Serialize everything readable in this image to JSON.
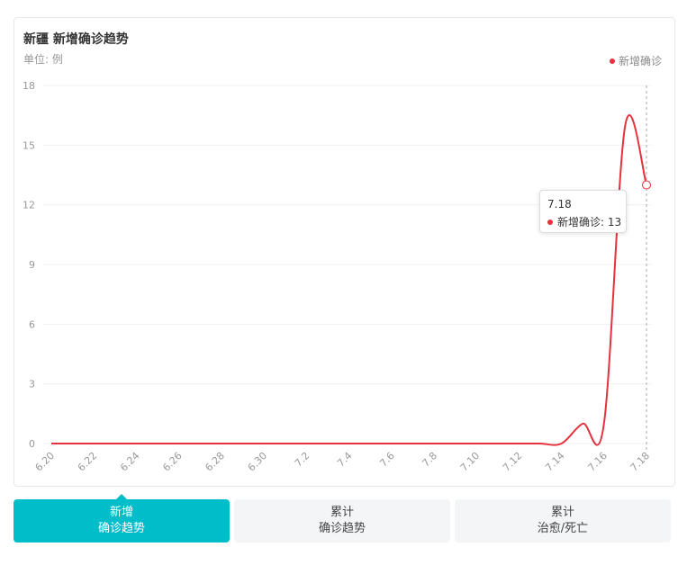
{
  "card": {
    "title": "新疆 新增确诊趋势",
    "unit": "单位: 例",
    "legend": "新增确诊"
  },
  "tooltip": {
    "date": "7.18",
    "label": "新增确诊: 13"
  },
  "tabs": [
    {
      "line1": "新增",
      "line2": "确诊趋势",
      "active": true
    },
    {
      "line1": "累计",
      "line2": "确诊趋势",
      "active": false
    },
    {
      "line1": "累计",
      "line2": "治愈/死亡",
      "active": false
    }
  ],
  "colors": {
    "line": "#e5323e",
    "accent": "#00bec9"
  },
  "chart_data": {
    "type": "line",
    "title": "新疆 新增确诊趋势",
    "ylabel": "单位: 例",
    "ylim": [
      0,
      18
    ],
    "yticks": [
      0,
      3,
      6,
      9,
      12,
      15,
      18
    ],
    "x": [
      "6.20",
      "6.21",
      "6.22",
      "6.23",
      "6.24",
      "6.25",
      "6.26",
      "6.27",
      "6.28",
      "6.29",
      "6.30",
      "7.1",
      "7.2",
      "7.3",
      "7.4",
      "7.5",
      "7.6",
      "7.7",
      "7.8",
      "7.9",
      "7.10",
      "7.11",
      "7.12",
      "7.13",
      "7.14",
      "7.15",
      "7.16",
      "7.17",
      "7.18"
    ],
    "xtick_labels": [
      "6.20",
      "6.22",
      "6.24",
      "6.26",
      "6.28",
      "6.30",
      "7.2",
      "7.4",
      "7.6",
      "7.8",
      "7.10",
      "7.12",
      "7.14",
      "7.16",
      "7.18"
    ],
    "series": [
      {
        "name": "新增确诊",
        "values": [
          0,
          0,
          0,
          0,
          0,
          0,
          0,
          0,
          0,
          0,
          0,
          0,
          0,
          0,
          0,
          0,
          0,
          0,
          0,
          0,
          0,
          0,
          0,
          0,
          0,
          1,
          1,
          16,
          13
        ]
      }
    ],
    "legend": "top-right",
    "grid": true
  }
}
